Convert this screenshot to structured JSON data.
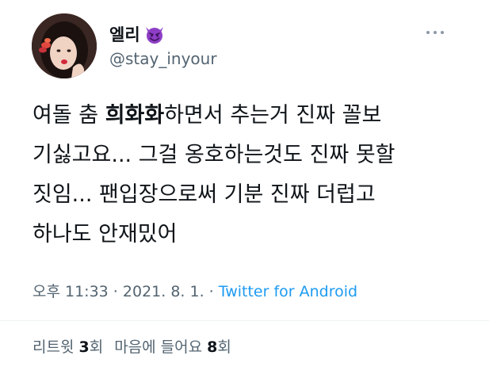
{
  "user": {
    "display_name": "엘리",
    "handle": "@stay_inyour",
    "name_emoji": "smiling-devil-emoji"
  },
  "tweet": {
    "text_part1": "여돌 춤 ",
    "text_bold": "희화화",
    "text_part2": "하면서 추는거 진짜 꼴보\n기싫고요... 그걸 옹호하는것도 진짜 못할\n짓임... 팬입장으로써 기분 진짜 더럽고\n하나도 안재밌어"
  },
  "meta": {
    "time": "오후 11:33",
    "separator1": " · ",
    "date": "2021. 8. 1.",
    "separator2": " · ",
    "source": "Twitter for Android"
  },
  "stats": {
    "retweets_label": "리트윗 ",
    "retweets_count": "3",
    "retweets_unit": "회",
    "likes_label": "마음에 들어요 ",
    "likes_count": "8",
    "likes_unit": "회"
  },
  "colors": {
    "text": "#0f1419",
    "secondary": "#536471",
    "link": "#1d9bf0",
    "emoji_purple": "#8e3ec6"
  },
  "icons": {
    "more": "more-dots-icon"
  }
}
